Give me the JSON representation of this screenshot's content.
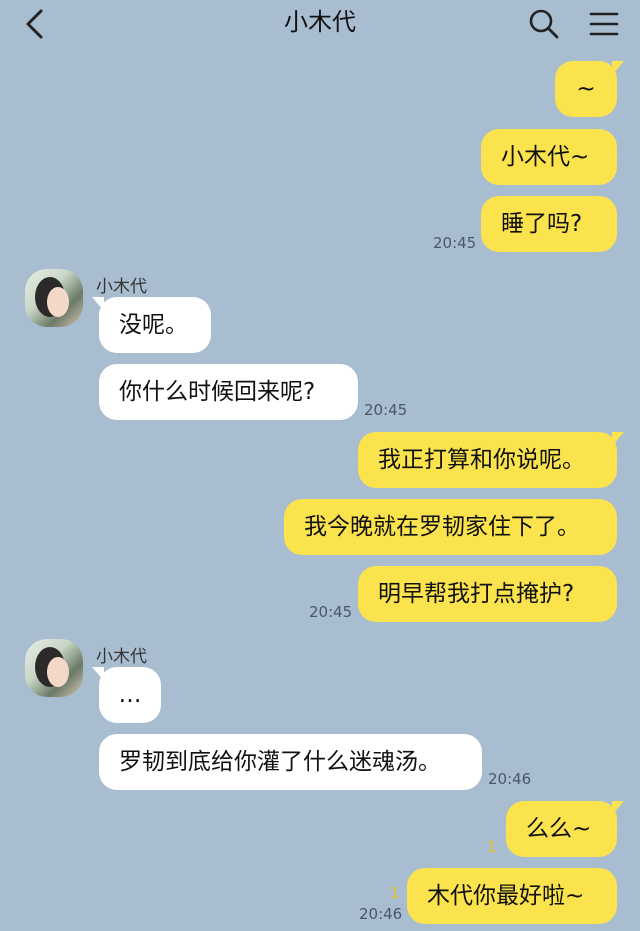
{
  "header": {
    "title": "小木代",
    "back_icon": "chevron-left-icon",
    "search_icon": "search-icon",
    "menu_icon": "menu-icon"
  },
  "messages": {
    "m1": "~",
    "m2": "小木代~",
    "m3": "睡了吗?",
    "t1": "20:45",
    "sender1": "小木代",
    "m4": "没呢。",
    "m5": "你什么时候回来呢?",
    "t2": "20:45",
    "m6": "我正打算和你说呢。",
    "m7": "我今晚就在罗韧家住下了。",
    "m8": "明早帮我打点掩护?",
    "t3": "20:45",
    "sender2": "小木代",
    "m9": "…",
    "m10": "罗韧到底给你灌了什么迷魂汤。",
    "t4": "20:46",
    "m11": "么么~",
    "u1": "1",
    "m12": "木代你最好啦~",
    "u2": "1",
    "t5": "20:46"
  },
  "colors": {
    "background": "#a9bdd0",
    "my_bubble": "#fbe34e",
    "their_bubble": "#ffffff"
  }
}
